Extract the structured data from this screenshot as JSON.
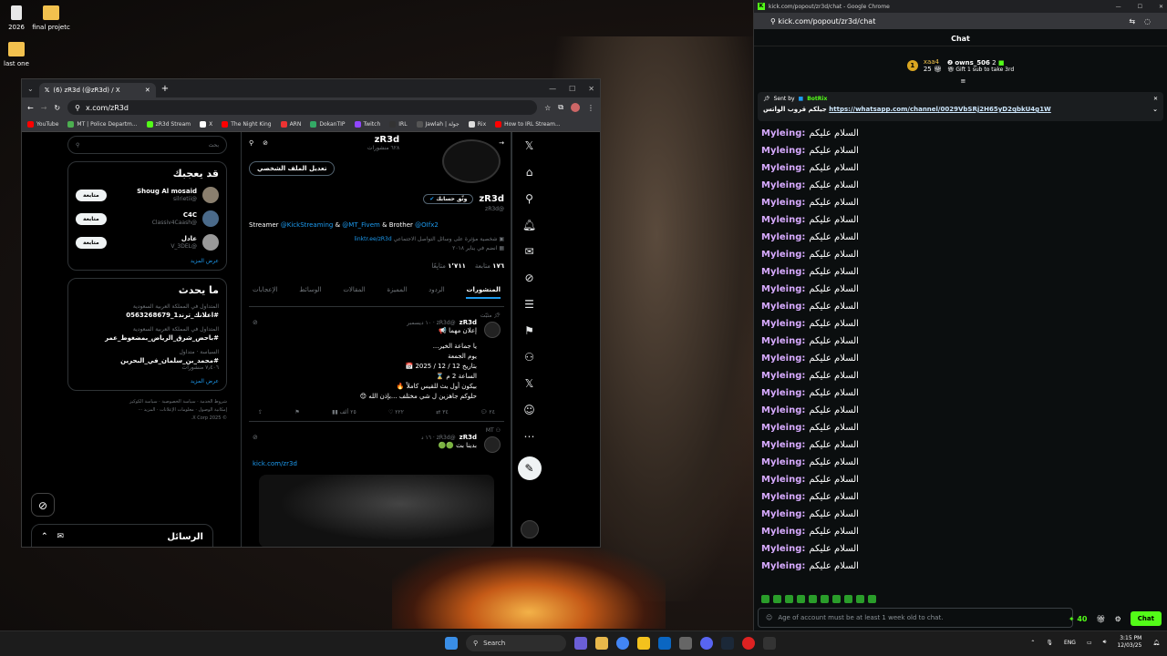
{
  "desktop": {
    "icons": [
      {
        "label": "2026",
        "kind": "file"
      },
      {
        "label": "final projetc",
        "kind": "folder"
      },
      {
        "label": "last one",
        "kind": "folder"
      }
    ]
  },
  "xbrowser": {
    "tab_title": "(6) zR3d (@zR3d) / X",
    "url": "x.com/zR3d",
    "bookmarks": [
      "YouTube",
      "MT | Police Departm...",
      "zR3d Stream",
      "X",
      "The Night King",
      "ARN",
      "DokanTIP",
      "Twitch",
      "IRL",
      "Jawlah | جولة",
      "Rix",
      "How to IRL Stream..."
    ],
    "profile": {
      "header_name": "zR3d",
      "header_posts": "٦٢٨ منشورات",
      "edit_profile": "تعديل الملف الشخصي",
      "name": "zR3d",
      "verify_btn": "وثّق حسابك",
      "handle": "@zR3d",
      "bio_prefix": "Streamer",
      "bio_link1": "@KickStreaming",
      "bio_mid1": "&",
      "bio_link2": "@MT_Fivem",
      "bio_mid2": "& Brother",
      "bio_link3": "@OIfx2",
      "category": "شخصية مؤثرة على وسائل التواصل الاجتماعي",
      "website": "linktr.ee/zR3d",
      "joined": "انضم في يناير ٢٠١٨",
      "following_num": "١٧٦",
      "following_label": "متابعة",
      "followers_num": "١٬٧١١",
      "followers_label": "متابِعًا",
      "tabs": [
        "المنشورات",
        "الردود",
        "المميزة",
        "المقالات",
        "الوسائط",
        "الإعجابات"
      ]
    },
    "tweets": [
      {
        "pinned": "مثبّت",
        "name": "zR3d",
        "meta": "@zR3d · ١٠ ديسمبر",
        "lines": [
          "إعلان مهما 📢",
          "يا جماعة الخير...",
          "يوم الجمعة",
          "بتاريخ 12 / 12 / 2025 📅",
          "الساعة 2 م ⌛",
          "بيكون أول بث للقيس كاملاً 🔥",
          "حلوكم جاهزين ل شي مختلف ...بإذن الله 😊"
        ],
        "actions": [
          "٢٤",
          "٣٤",
          "٢٢٢",
          "٢٥ ألف",
          "",
          ""
        ]
      },
      {
        "pinned": "MT",
        "name": "zR3d",
        "meta": "@zR3d · ١٦ د",
        "lines": [
          "بدينا بث 🟢🟢"
        ],
        "link": "kick.com/zr3d"
      }
    ],
    "sidebar": {
      "search_placeholder": "بحث",
      "who_title": "قد يعجبك",
      "who": [
        {
          "name": "Shoug Al mosaid",
          "handle": "@silrietii",
          "btn": "متابعة",
          "color": "#8a7f6e"
        },
        {
          "name": "C4C",
          "handle": "@Classiv4Caash",
          "btn": "متابعة",
          "color": "#4a6a8a"
        },
        {
          "name": "عادل",
          "handle": "@V_3DEL",
          "btn": "متابعة",
          "color": "#999999"
        }
      ],
      "show_more": "عرض المزيد",
      "trends_title": "ما يحدث",
      "trends": [
        {
          "ctx": "المتداول في المملكة العربية السعودية",
          "tag": "#اعلانك_ترند1_0563268679",
          "count": ""
        },
        {
          "ctx": "المتداول في المملكة العربية السعودية",
          "tag": "#باحض_شرق_الرياض_بمضغوط_عمر",
          "count": ""
        },
        {
          "ctx": "السياسة · متداول",
          "tag": "#محمد_بن_سلمان_في_البحرين",
          "count": "٧٫٤٠٦ منشورات"
        }
      ],
      "show_more2": "عرض المزيد",
      "footer": [
        "شروط الخدمة",
        "سياسة الخصوصية",
        "سياسة الكوكيز",
        "إمكانية الوصول",
        "معلومات الإعلانات",
        "المزيد ···",
        "© 2025 X Corp."
      ],
      "messages": "الرسائل"
    }
  },
  "kick": {
    "window_title": "kick.com/popout/zr3d/chat - Google Chrome",
    "url": "kick.com/popout/zr3d/chat",
    "header": "Chat",
    "leader": {
      "rank": "1",
      "name1": "xaa4",
      "count1": "25",
      "name2": "owns_506",
      "count2": "2",
      "gift_text": "Gift 1 sub to take 3rd"
    },
    "pinned": {
      "sent_by": "Sent by",
      "bot": "BotRix",
      "prefix": "جيلكم قروب الواتس",
      "link": "https://whatsapp.com/channel/0029VbSRj2H65yD2qbkU4g1W"
    },
    "messages": [
      {
        "user": "Myleing:",
        "text": "السلام عليكم"
      },
      {
        "user": "Myleing:",
        "text": "السلام عليكم"
      },
      {
        "user": "Myleing:",
        "text": "السلام عليكم"
      },
      {
        "user": "Myleing:",
        "text": "السلام عليكم"
      },
      {
        "user": "Myleing:",
        "text": "السلام عليكم"
      },
      {
        "user": "Myleing:",
        "text": "السلام عليكم"
      },
      {
        "user": "Myleing:",
        "text": "السلام عليكم"
      },
      {
        "user": "Myleing:",
        "text": "السلام عليكم"
      },
      {
        "user": "Myleing:",
        "text": "السلام عليكم"
      },
      {
        "user": "Myleing:",
        "text": "السلام عليكم"
      },
      {
        "user": "Myleing:",
        "text": "السلام عليكم"
      },
      {
        "user": "Myleing:",
        "text": "السلام عليكم"
      },
      {
        "user": "Myleing:",
        "text": "السلام عليكم"
      },
      {
        "user": "Myleing:",
        "text": "السلام عليكم"
      },
      {
        "user": "Myleing:",
        "text": "السلام عليكم"
      },
      {
        "user": "Myleing:",
        "text": "السلام عليكم"
      },
      {
        "user": "Myleing:",
        "text": "السلام عليكم"
      },
      {
        "user": "Myleing:",
        "text": "السلام عليكم"
      },
      {
        "user": "Myleing:",
        "text": "السلام عليكم"
      },
      {
        "user": "Myleing:",
        "text": "السلام عليكم"
      },
      {
        "user": "Myleing:",
        "text": "السلام عليكم"
      },
      {
        "user": "Myleing:",
        "text": "السلام عليكم"
      },
      {
        "user": "Myleing:",
        "text": "السلام عليكم"
      },
      {
        "user": "Myleing:",
        "text": "السلام عليكم"
      },
      {
        "user": "Myleing:",
        "text": "السلام عليكم"
      },
      {
        "user": "Myleing:",
        "text": "السلام عليكم"
      }
    ],
    "input_placeholder": "Age of account must be at least 1 week old to chat.",
    "points": "40",
    "chat_btn": "Chat"
  },
  "taskbar": {
    "search": "Search",
    "lang": "ENG",
    "time": "3:15 PM",
    "date": "12/03/25"
  },
  "colors": {
    "accent_kick": "#53fc18",
    "accent_x": "#1d9bf0",
    "chat_user": "#d7aaff"
  }
}
